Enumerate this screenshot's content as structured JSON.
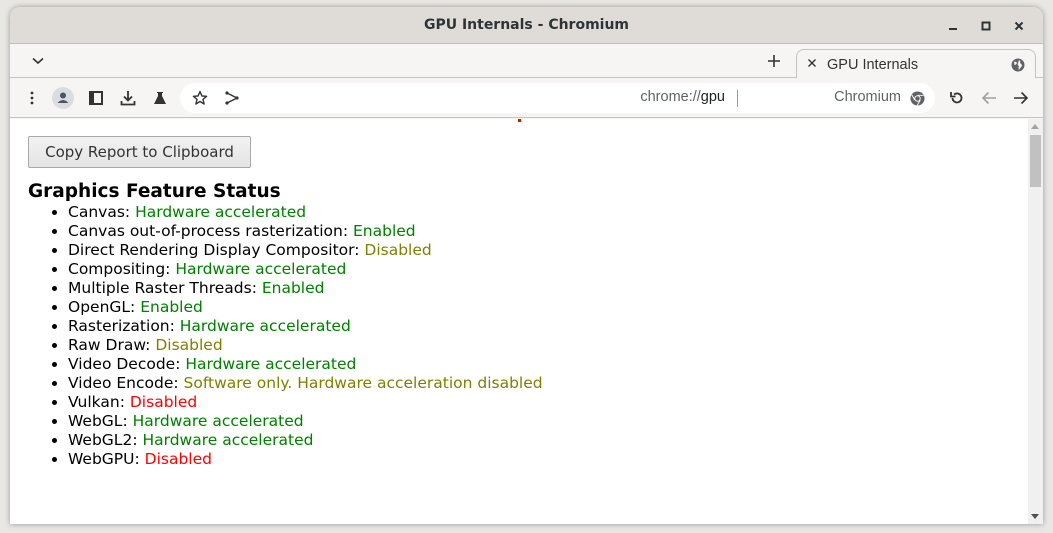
{
  "window": {
    "title": "GPU Internals - Chromium",
    "controls": {
      "minimize": "_",
      "maximize": "□",
      "close": "✕"
    }
  },
  "tabstrip": {
    "new_tab_label": "+",
    "tabs": [
      {
        "title": "GPU Internals",
        "close_label": "✕",
        "icon": "globe-icon",
        "active": true
      }
    ]
  },
  "toolbar": {
    "icons": [
      "menu-dots-icon",
      "profile-icon",
      "side-panel-icon",
      "download-icon",
      "labs-flask-icon"
    ],
    "omnibox": {
      "url_scheme": "chrome://",
      "url_host": "gpu",
      "label": "Chromium",
      "icons": [
        "bookmark-star-icon",
        "share-icon",
        "chromium-icon"
      ]
    },
    "nav_icons": [
      "reload-icon",
      "back-icon",
      "forward-icon"
    ]
  },
  "page": {
    "copy_button_label": "Copy Report to Clipboard",
    "heading": "Graphics Feature Status",
    "features": [
      {
        "name": "Canvas",
        "status": "Hardware accelerated",
        "level": "ok"
      },
      {
        "name": "Canvas out-of-process rasterization",
        "status": "Enabled",
        "level": "ok"
      },
      {
        "name": "Direct Rendering Display Compositor",
        "status": "Disabled",
        "level": "warn"
      },
      {
        "name": "Compositing",
        "status": "Hardware accelerated",
        "level": "ok"
      },
      {
        "name": "Multiple Raster Threads",
        "status": "Enabled",
        "level": "ok"
      },
      {
        "name": "OpenGL",
        "status": "Enabled",
        "level": "ok"
      },
      {
        "name": "Rasterization",
        "status": "Hardware accelerated",
        "level": "ok"
      },
      {
        "name": "Raw Draw",
        "status": "Disabled",
        "level": "warn"
      },
      {
        "name": "Video Decode",
        "status": "Hardware accelerated",
        "level": "ok"
      },
      {
        "name": "Video Encode",
        "status": "Software only. Hardware acceleration disabled",
        "level": "warn"
      },
      {
        "name": "Vulkan",
        "status": "Disabled",
        "level": "bad"
      },
      {
        "name": "WebGL",
        "status": "Hardware accelerated",
        "level": "ok"
      },
      {
        "name": "WebGL2",
        "status": "Hardware accelerated",
        "level": "ok"
      },
      {
        "name": "WebGPU",
        "status": "Disabled",
        "level": "bad"
      }
    ],
    "status_colors": {
      "ok": "#008000",
      "warn": "#808000",
      "bad": "#ff0000"
    }
  }
}
